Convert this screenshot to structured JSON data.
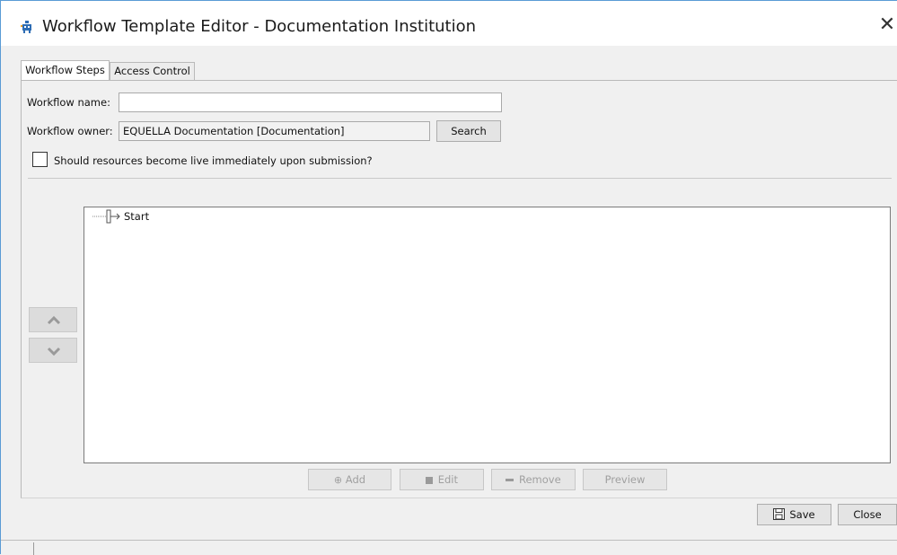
{
  "window": {
    "title": "Workflow Template Editor - Documentation Institution",
    "close_glyph": "✕",
    "title_icon": "workflow-app-icon"
  },
  "tabs": [
    {
      "label": "Workflow Steps",
      "active": true
    },
    {
      "label": "Access Control",
      "active": false
    }
  ],
  "form": {
    "name_label": "Workflow name:",
    "name_value": "",
    "owner_label": "Workflow owner:",
    "owner_value": "EQUELLA Documentation [Documentation]",
    "search_label": "Search",
    "live_checkbox_label": "Should resources become live immediately upon submission?",
    "live_checked": false
  },
  "tree": {
    "root_label": "Start"
  },
  "step_actions": {
    "add_label": "Add",
    "edit_label": "Edit",
    "remove_label": "Remove",
    "preview_label": "Preview"
  },
  "footer": {
    "save_label": "Save",
    "close_label": "Close"
  },
  "colors": {
    "accent_border": "#5a9bd5",
    "icon_blue": "#2e6db4",
    "disabled_text": "#a0a0a0"
  }
}
